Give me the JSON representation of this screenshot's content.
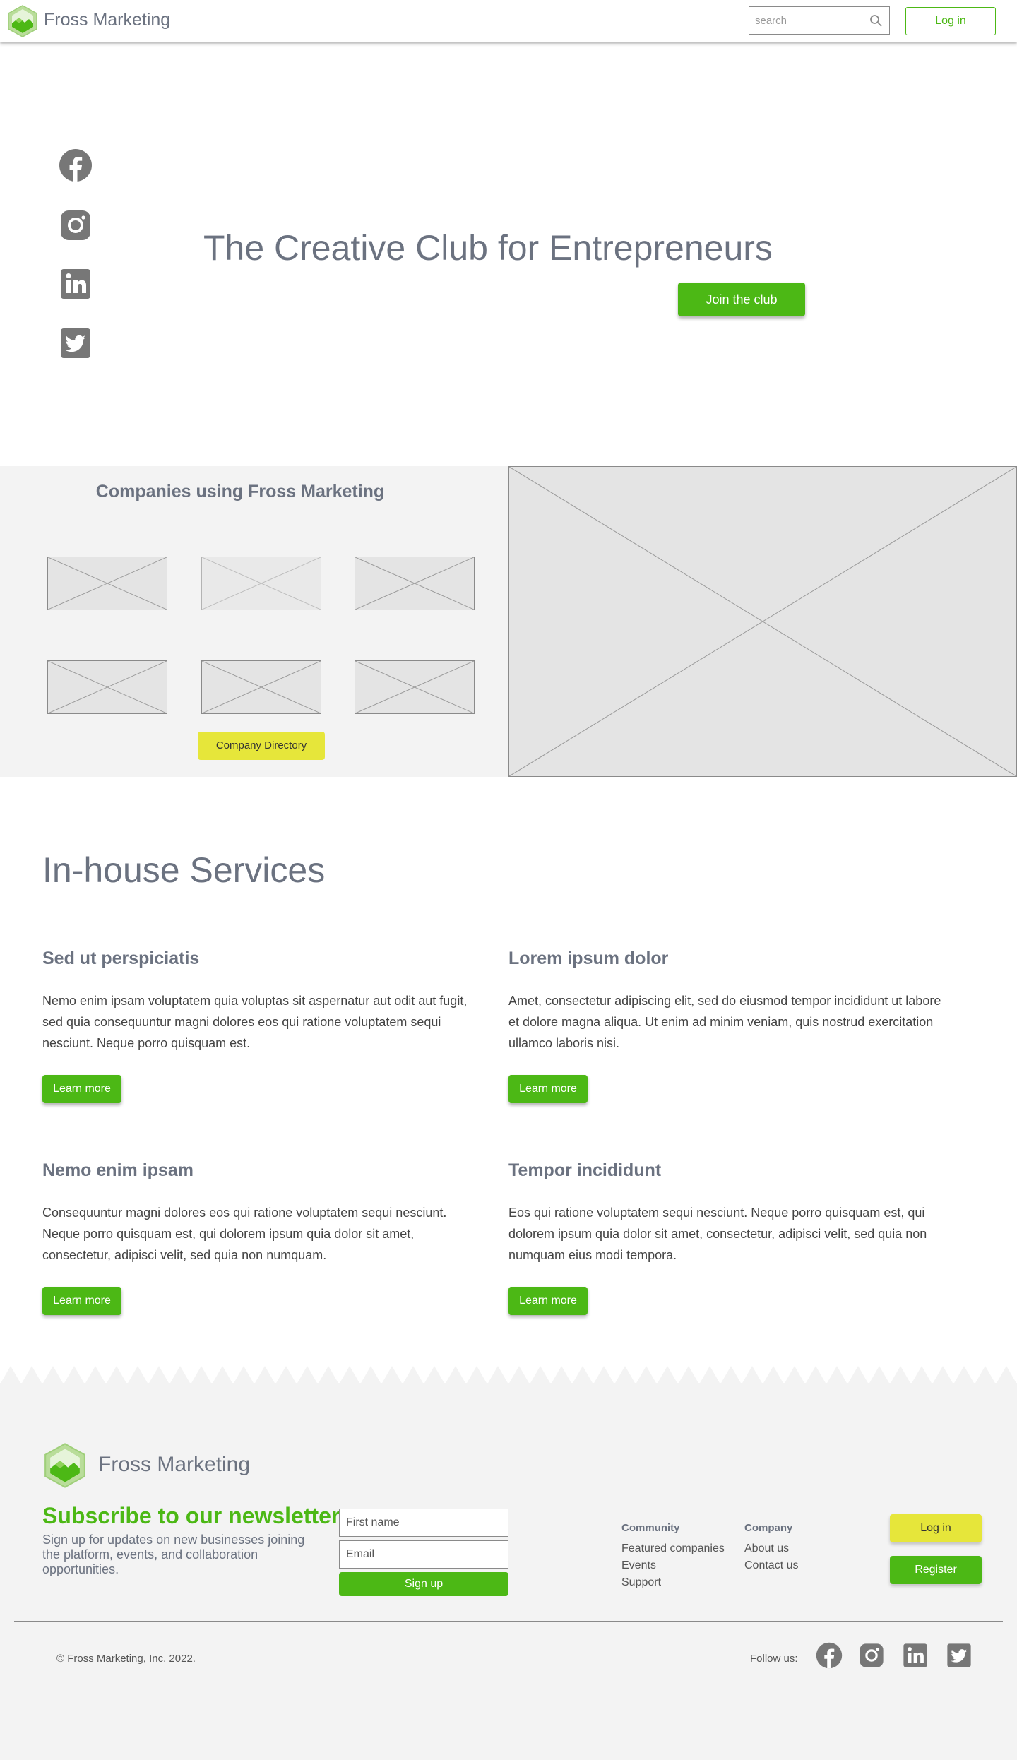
{
  "colors": {
    "accent": "#4cb815",
    "yellow": "#e6e63a",
    "text_gray": "#6b7280",
    "icon_gray": "#777777",
    "panel_bg": "#f3f3f3"
  },
  "header": {
    "brand": "Fross Marketing",
    "search_placeholder": "search",
    "login_label": "Log in"
  },
  "hero": {
    "title": "The Creative Club for Entrepreneurs",
    "cta_label": "Join the club",
    "social_icons": [
      "facebook-icon",
      "instagram-icon",
      "linkedin-icon",
      "twitter-icon"
    ]
  },
  "companies": {
    "title": "Companies using Fross Marketing",
    "directory_label": "Company Directory"
  },
  "services": {
    "title": "In-house Services",
    "items": [
      {
        "title": "Sed ut perspiciatis",
        "text": "Nemo enim ipsam voluptatem quia voluptas sit aspernatur aut odit aut fugit, sed quia consequuntur magni dolores eos qui ratione voluptatem sequi nesciunt. Neque porro quisquam est.",
        "button": "Learn more"
      },
      {
        "title": "Lorem ipsum dolor",
        "text": "Amet, consectetur adipiscing elit, sed do eiusmod tempor incididunt ut labore et dolore magna aliqua. Ut enim ad minim veniam, quis nostrud exercitation ullamco laboris nisi.",
        "button": "Learn more"
      },
      {
        "title": "Nemo enim ipsam",
        "text": "Consequuntur magni dolores eos qui ratione voluptatem sequi nesciunt. Neque porro quisquam est, qui dolorem ipsum quia dolor sit amet, consectetur, adipisci velit, sed quia non numquam.",
        "button": "Learn more"
      },
      {
        "title": "Tempor incididunt",
        "text": "Eos qui ratione voluptatem sequi nesciunt. Neque porro quisquam est, qui dolorem ipsum quia dolor sit amet, consectetur, adipisci velit, sed quia non numquam eius modi tempora.",
        "button": "Learn more"
      }
    ]
  },
  "footer": {
    "brand": "Fross Marketing",
    "newsletter_title": "Subscribe to our newsletter",
    "newsletter_text": "Sign up for updates on new businesses joining the platform, events, and collaboration opportunities.",
    "first_name_placeholder": "First name",
    "email_placeholder": "Email",
    "signup_label": "Sign up",
    "community": {
      "heading": "Community",
      "links": [
        "Featured companies",
        "Events",
        "Support"
      ]
    },
    "company": {
      "heading": "Company",
      "links": [
        "About us",
        "Contact us"
      ]
    },
    "login_label": "Log in",
    "register_label": "Register",
    "copyright": "© Fross Marketing, Inc. 2022.",
    "follow_label": "Follow us:"
  }
}
